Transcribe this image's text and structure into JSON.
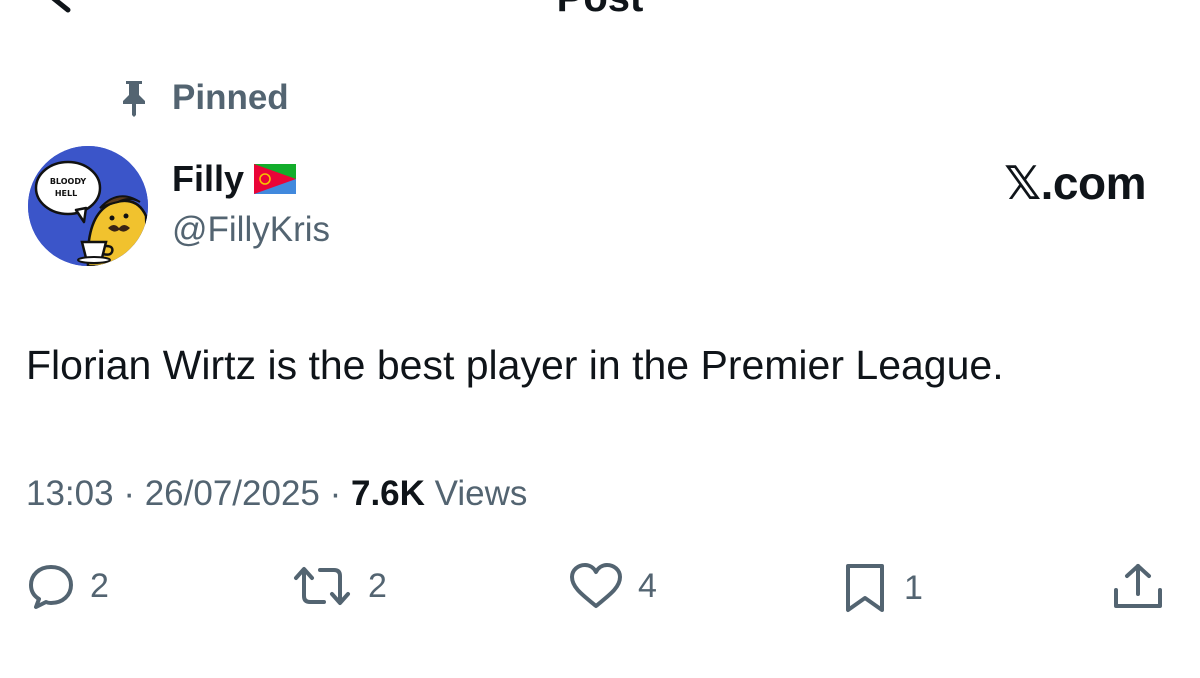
{
  "topbar": {
    "title": "Post"
  },
  "pinned": {
    "label": "Pinned"
  },
  "author": {
    "display_name": "Filly",
    "handle": "@FillyKris",
    "avatar_speech": [
      "BLOODY",
      "HELL"
    ]
  },
  "watermark": "𝕏.com",
  "tweet": {
    "text": "Florian Wirtz is the best player in the Premier League."
  },
  "meta": {
    "time": "13:03",
    "sep1": " · ",
    "date": "26/07/2025",
    "sep2": " · ",
    "views_count": "7.6K",
    "views_label": " Views"
  },
  "actions": {
    "reply_count": "2",
    "repost_count": "2",
    "like_count": "4",
    "bookmark_count": "1"
  },
  "colors": {
    "text_primary": "#0f1419",
    "text_secondary": "#536471",
    "avatar_bg": "#3b55c9"
  },
  "icons": [
    "chevron-left-icon",
    "more-icon",
    "pin-icon",
    "eritrea-flag-icon",
    "reply-icon",
    "repost-icon",
    "like-icon",
    "bookmark-icon",
    "share-icon"
  ]
}
